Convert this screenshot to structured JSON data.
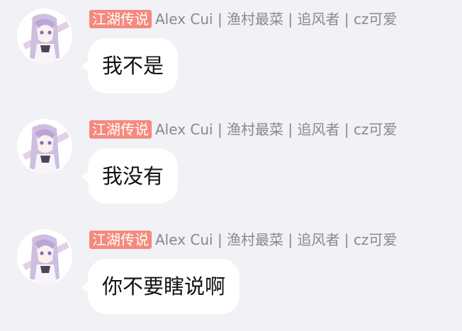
{
  "colors": {
    "background": "#f1f1f6",
    "badge": "#f5897d",
    "sender_text": "#888891",
    "bubble": "#ffffff"
  },
  "messages": [
    {
      "avatar_icon": "anime-girl-avatar-icon",
      "badge": "江湖传说",
      "sender": "Alex Cui | 渔村最菜 | 追风者 | cz可爱",
      "text": "我不是"
    },
    {
      "avatar_icon": "anime-girl-avatar-icon",
      "badge": "江湖传说",
      "sender": "Alex Cui | 渔村最菜 | 追风者 | cz可爱",
      "text": "我没有"
    },
    {
      "avatar_icon": "anime-girl-avatar-icon",
      "badge": "江湖传说",
      "sender": "Alex Cui | 渔村最菜 | 追风者 | cz可爱",
      "text": "你不要瞎说啊"
    }
  ]
}
